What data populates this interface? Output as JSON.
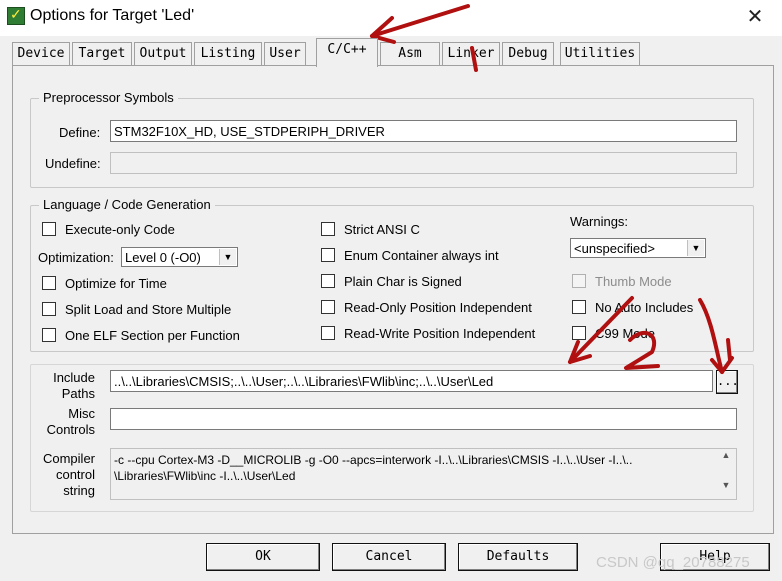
{
  "window": {
    "title": "Options for Target 'Led'",
    "close_glyph": "✕"
  },
  "tabs": [
    {
      "label": "Device"
    },
    {
      "label": "Target"
    },
    {
      "label": "Output"
    },
    {
      "label": "Listing"
    },
    {
      "label": "User"
    },
    {
      "label": "C/C++",
      "active": true
    },
    {
      "label": "Asm"
    },
    {
      "label": "Linker"
    },
    {
      "label": "Debug"
    },
    {
      "label": "Utilities"
    }
  ],
  "preprocessor": {
    "title": "Preprocessor Symbols",
    "define_label": "Define:",
    "define_value": "STM32F10X_HD, USE_STDPERIPH_DRIVER",
    "undefine_label": "Undefine:",
    "undefine_value": ""
  },
  "language": {
    "title": "Language / Code Generation",
    "execute_only": "Execute-only Code",
    "optimization_label": "Optimization:",
    "optimization_value": "Level 0 (-O0)",
    "optimize_time": "Optimize for Time",
    "split_load": "Split Load and Store Multiple",
    "one_elf": "One ELF Section per Function",
    "strict_ansi": "Strict ANSI C",
    "enum_container": "Enum Container always int",
    "plain_char": "Plain Char is Signed",
    "ro_pi": "Read-Only Position Independent",
    "rw_pi": "Read-Write Position Independent",
    "warnings_label": "Warnings:",
    "warnings_value": "<unspecified>",
    "thumb_mode": "Thumb Mode",
    "no_auto_includes": "No Auto Includes",
    "c99_mode": "C99 Mode"
  },
  "paths": {
    "include_label_1": "Include",
    "include_label_2": "Paths",
    "include_value": "..\\..\\Libraries\\CMSIS;..\\..\\User;..\\..\\Libraries\\FWlib\\inc;..\\..\\User\\Led",
    "browse_label": "...",
    "misc_label_1": "Misc",
    "misc_label_2": "Controls",
    "misc_value": "",
    "compiler_label_1": "Compiler",
    "compiler_label_2": "control",
    "compiler_label_3": "string",
    "compiler_line_1": "-c --cpu Cortex-M3 -D__MICROLIB -g -O0 --apcs=interwork -I..\\..\\Libraries\\CMSIS -I..\\..\\User -I..\\..",
    "compiler_line_2": "\\Libraries\\FWlib\\inc -I..\\..\\User\\Led"
  },
  "buttons": {
    "ok": "OK",
    "cancel": "Cancel",
    "defaults": "Defaults",
    "help": "Help"
  },
  "annotations": {
    "mark_1": "1",
    "mark_2": "2",
    "color": "#b01010"
  },
  "watermark": "CSDN @qq_20788275"
}
